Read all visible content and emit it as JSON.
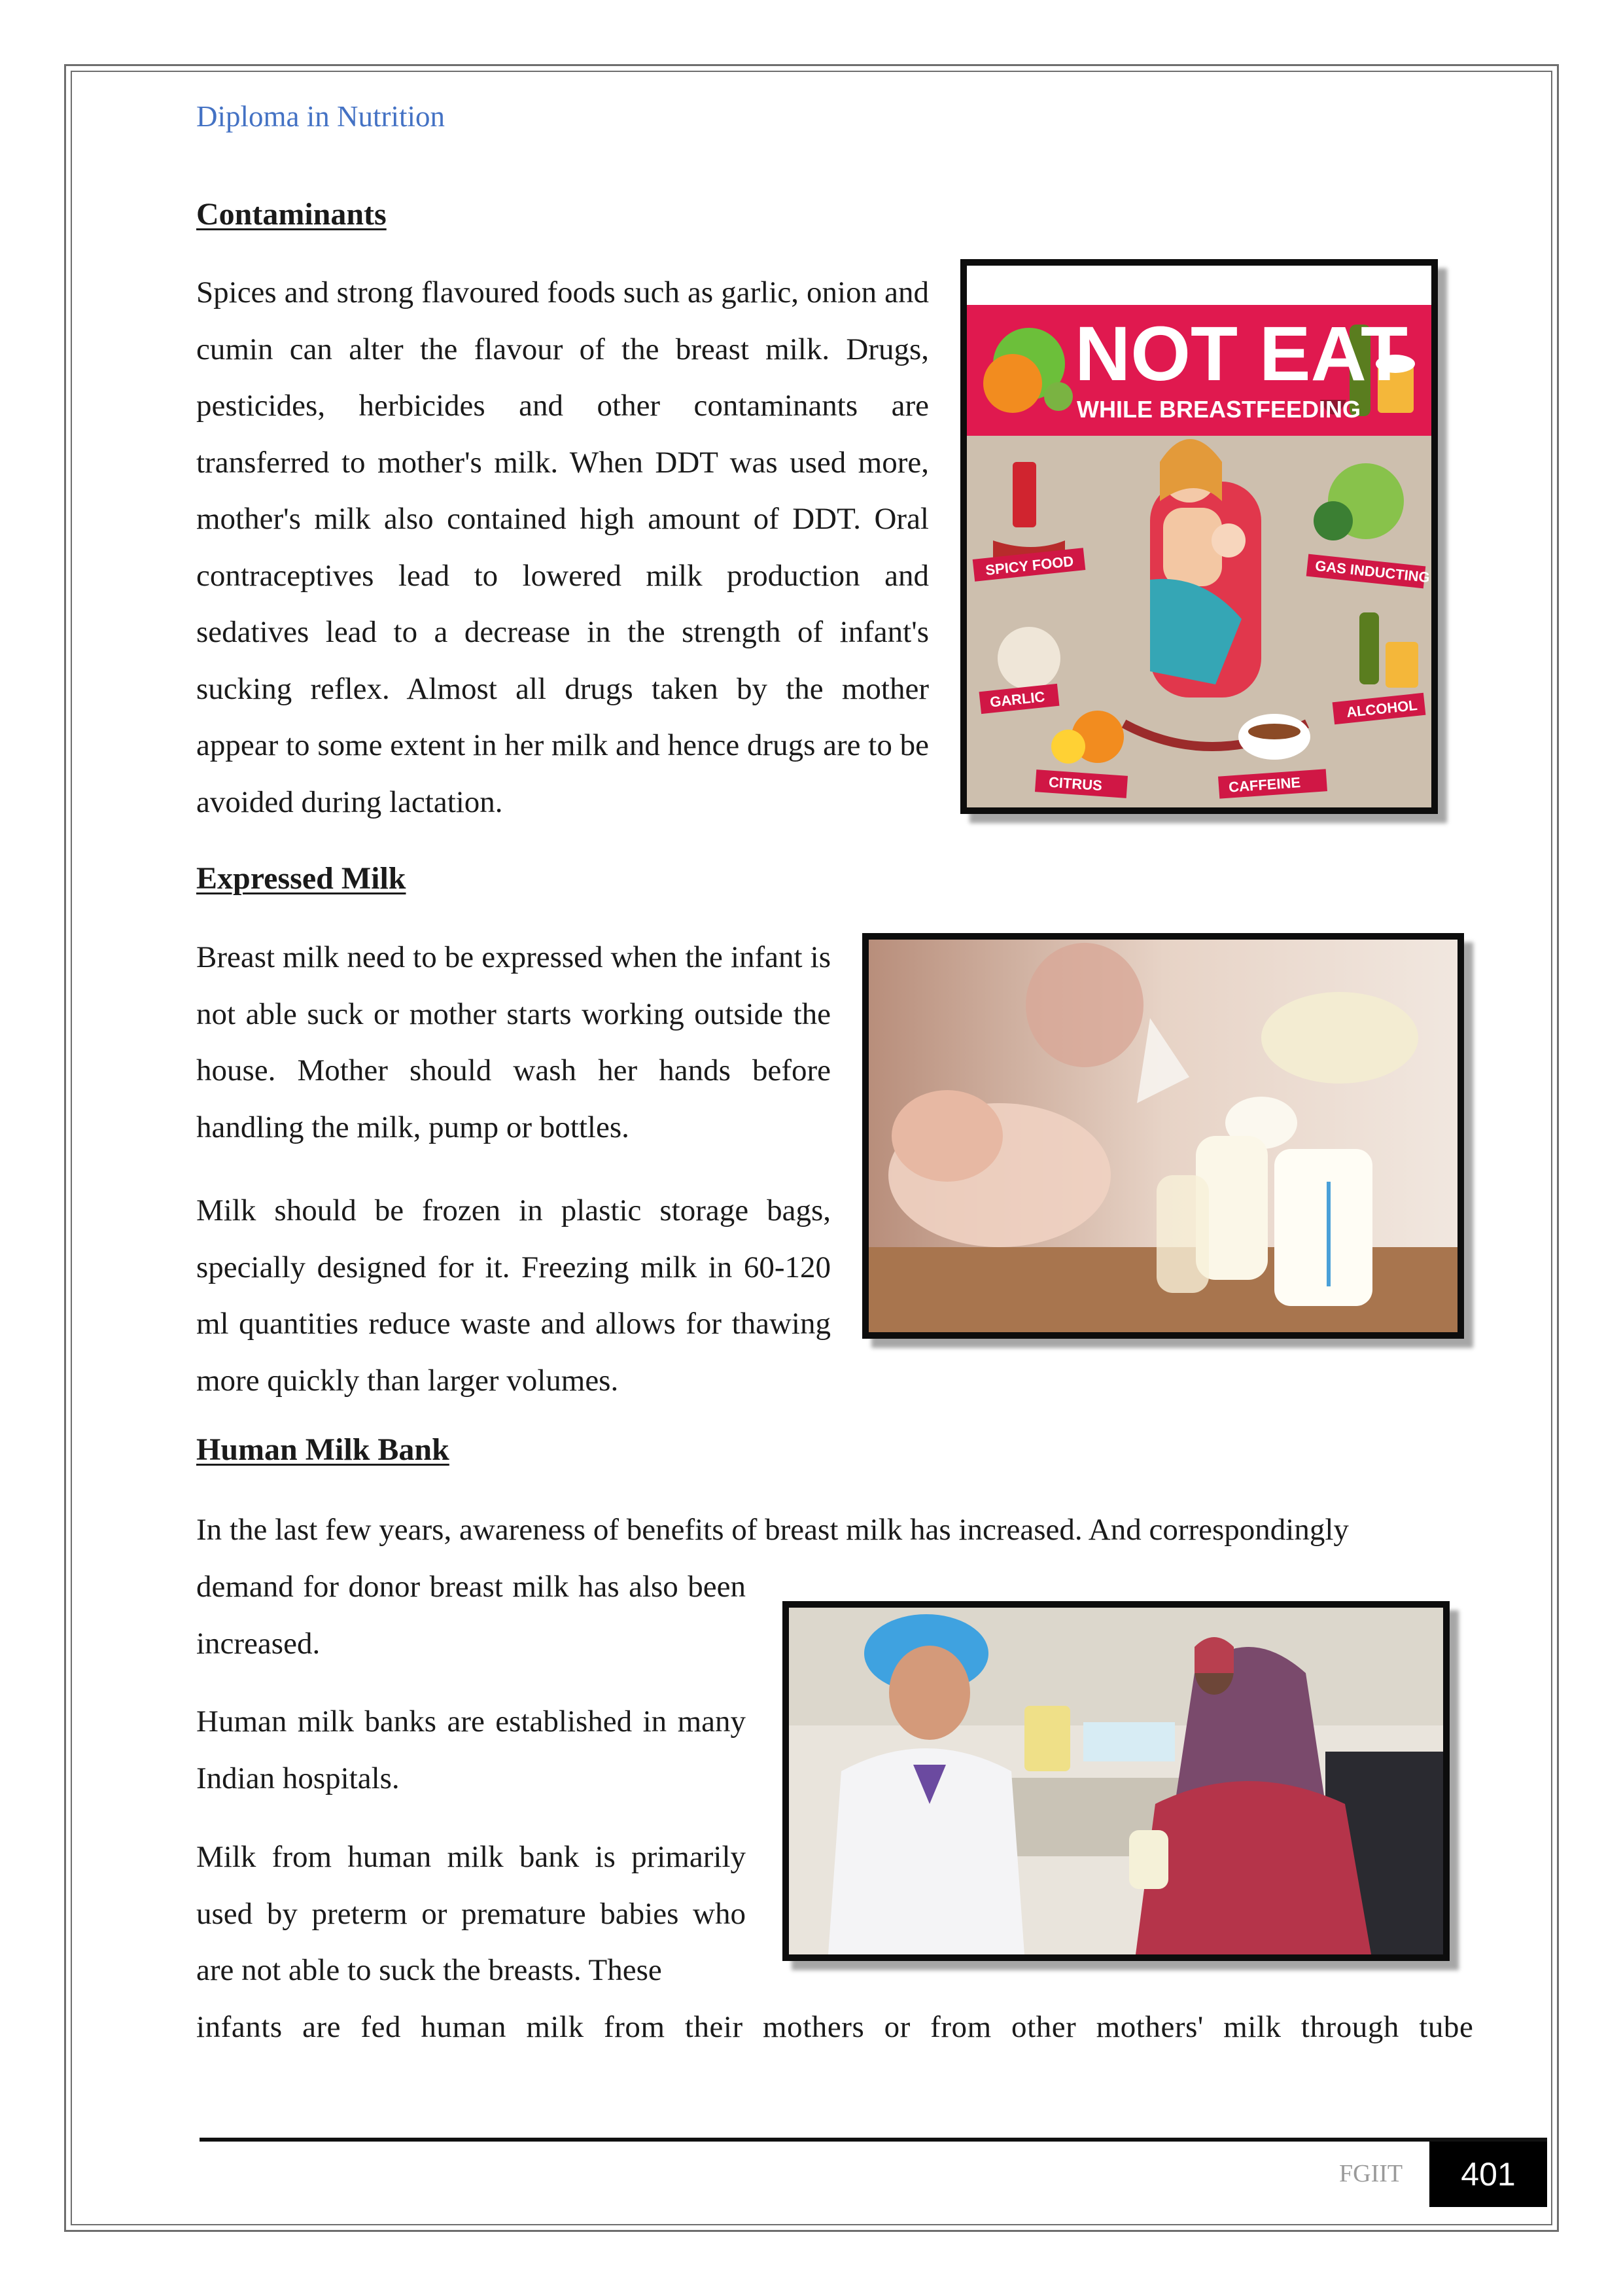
{
  "header": {
    "title": "Diploma in Nutrition"
  },
  "sections": {
    "contaminants": {
      "heading": "Contaminants",
      "paragraph": "Spices and strong flavoured foods such as garlic, onion and cumin can alter the flavour of the breast milk. Drugs, pesticides, herbicides and other contaminants are transferred to mother's milk. When DDT was used more, mother's milk also contained high amount of DDT. Oral contraceptives lead to lowered milk production and sedatives lead to a decrease in the strength of infant's sucking reflex. Almost all drugs taken by the mother appear to some extent in her milk and hence drugs are to be avoided during lactation."
    },
    "expressed_milk": {
      "heading": "Expressed Milk",
      "paragraph_1": "Breast milk need to be expressed when the infant is not able suck or mother starts working outside the house. Mother should wash her hands before handling the milk, pump or bottles.",
      "paragraph_2": "Milk should be frozen in plastic storage bags, specially designed for it. Freezing milk in 60-120 ml quantities reduce waste and allows for thawing more quickly than larger volumes."
    },
    "human_milk_bank": {
      "heading": "Human Milk Bank",
      "paragraph_1_line_1": "In the last few years, awareness of benefits of breast milk has increased. And correspondingly",
      "paragraph_1_rest": "demand for donor breast milk has also been increased.",
      "paragraph_2": "Human milk banks are established in many Indian hospitals.",
      "paragraph_3_part": "Milk from human milk bank is primarily used by preterm or premature babies who are not able to suck the breasts. These",
      "paragraph_3_last_line": "infants are fed human milk from their mothers or from other mothers' milk through tube"
    }
  },
  "poster": {
    "title": "NOT EAT",
    "subtitle": "WHILE BREASTFEEDING",
    "labels": [
      "SPICY FOOD",
      "GAS INDUCTING",
      "GARLIC",
      "ALCOHOL",
      "CITRUS",
      "CAFFEINE"
    ],
    "colors": {
      "banner": "#e0194f",
      "background": "#cdbfae",
      "ribbon": "#d01745"
    }
  },
  "footer": {
    "org": "FGIIT",
    "page_number": "401"
  }
}
